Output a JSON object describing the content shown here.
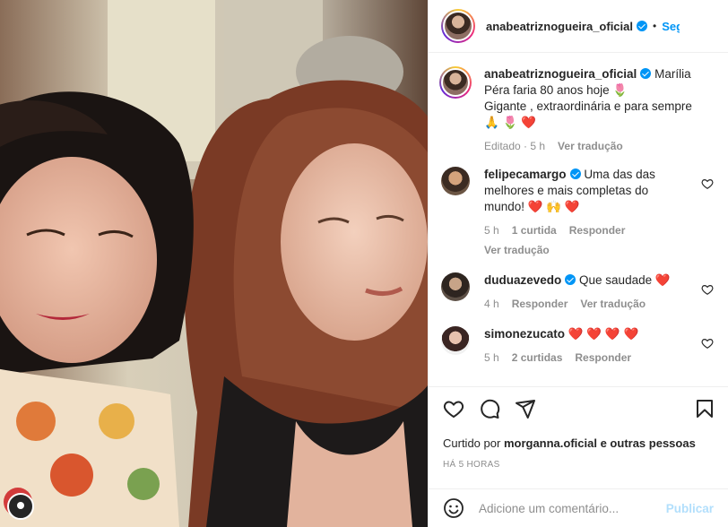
{
  "post": {
    "username": "anabeatriznogueira_oficial",
    "follow_label": "Seguir",
    "caption_lines": [
      "Marília",
      "Péra faria 80 anos hoje 🌷",
      "Gigante , extraordinária e para sempre",
      "🙏 🌷 ❤️"
    ],
    "caption_meta_edited": "Editado · 5 h",
    "caption_meta_translate": "Ver tradução"
  },
  "comments": [
    {
      "username": "felipecamargo",
      "text": "Uma das das melhores e mais completas do mundo! ❤️ 🙌 ❤️",
      "time": "5 h",
      "likes": "1 curtida",
      "reply": "Responder",
      "translate": "Ver tradução"
    },
    {
      "username": "duduazevedo",
      "text": "Que saudade ❤️",
      "time": "4 h",
      "reply": "Responder",
      "translate": "Ver tradução"
    },
    {
      "username": "simonezucato",
      "text": "❤️ ❤️ ❤️ ❤️",
      "time": "5 h",
      "likes": "2 curtidas",
      "reply": "Responder"
    }
  ],
  "liked_by": {
    "prefix": "Curtido por",
    "user": "morganna.oficial",
    "suffix": "e outras pessoas"
  },
  "post_time": "HÁ 5 HORAS",
  "add_comment": {
    "placeholder": "Adicione um comentário...",
    "publish": "Publicar"
  },
  "icons": [
    "heart-icon",
    "comment-icon",
    "share-icon",
    "bookmark-icon",
    "emoji-icon",
    "verified-icon"
  ],
  "colors": {
    "accent": "#0095f6",
    "like": "#ed4956",
    "muted": "#8e8e8e",
    "publish_disabled": "#b2dffc"
  }
}
